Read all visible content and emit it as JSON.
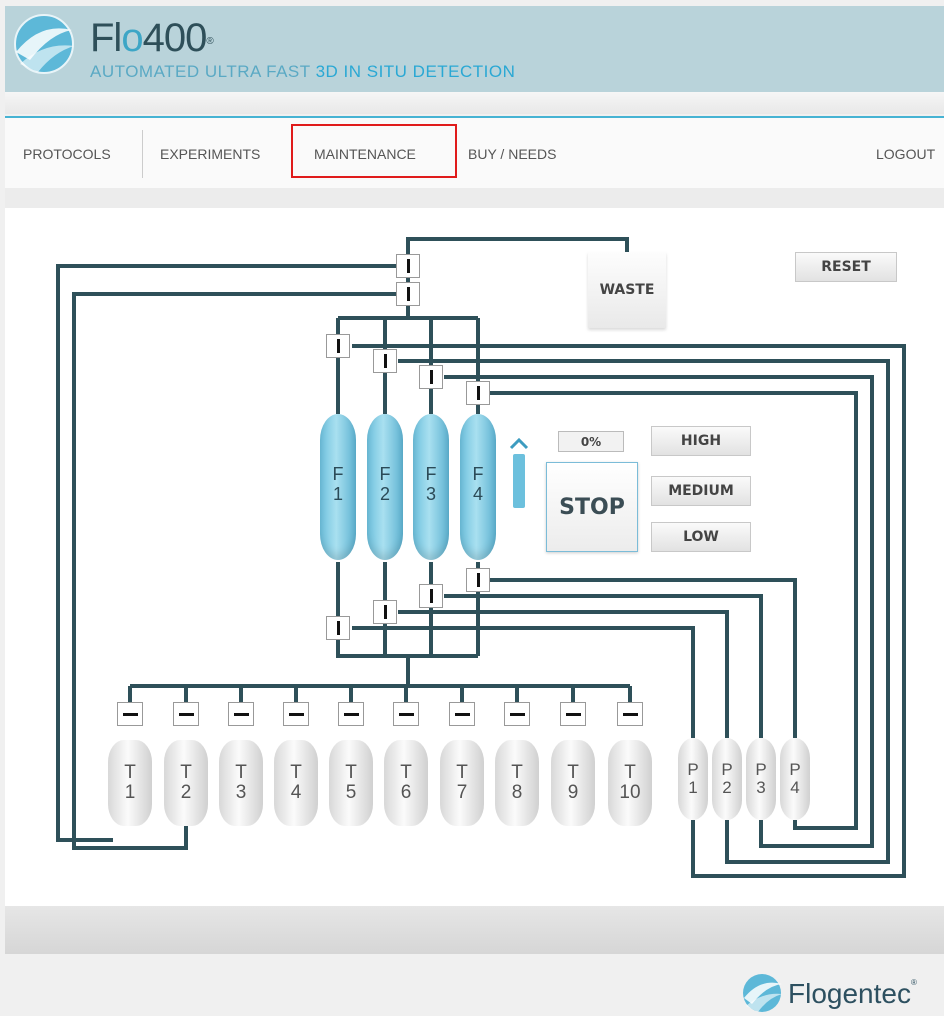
{
  "header": {
    "brand_prefix": "Fl",
    "brand_o": "o",
    "brand_number": "400",
    "brand_mark": "®",
    "tagline_start": "AUTOMATED ULTRA FAST ",
    "tagline_accent": "3D IN SITU DETECTION"
  },
  "nav": {
    "protocols": "PROTOCOLS",
    "experiments": "EXPERIMENTS",
    "maintenance": "MAINTENANCE",
    "buy_needs": "BUY / NEEDS",
    "logout": "LOGOUT"
  },
  "controls": {
    "reset": "RESET",
    "waste": "WASTE",
    "stop": "STOP",
    "percent": "0%",
    "high": "HIGH",
    "medium": "MEDIUM",
    "low": "LOW"
  },
  "columns": [
    {
      "letter": "F",
      "num": "1"
    },
    {
      "letter": "F",
      "num": "2"
    },
    {
      "letter": "F",
      "num": "3"
    },
    {
      "letter": "F",
      "num": "4"
    }
  ],
  "tubes": [
    {
      "letter": "T",
      "num": "1"
    },
    {
      "letter": "T",
      "num": "2"
    },
    {
      "letter": "T",
      "num": "3"
    },
    {
      "letter": "T",
      "num": "4"
    },
    {
      "letter": "T",
      "num": "5"
    },
    {
      "letter": "T",
      "num": "6"
    },
    {
      "letter": "T",
      "num": "7"
    },
    {
      "letter": "T",
      "num": "8"
    },
    {
      "letter": "T",
      "num": "9"
    },
    {
      "letter": "T",
      "num": "10"
    }
  ],
  "pumps": [
    {
      "letter": "P",
      "num": "1"
    },
    {
      "letter": "P",
      "num": "2"
    },
    {
      "letter": "P",
      "num": "3"
    },
    {
      "letter": "P",
      "num": "4"
    }
  ],
  "colors": {
    "pipe": "#2e5059",
    "accent": "#46b3d3",
    "highlight": "#e01b1b"
  },
  "footer": {
    "brand": "Flogentec",
    "mark": "®"
  }
}
